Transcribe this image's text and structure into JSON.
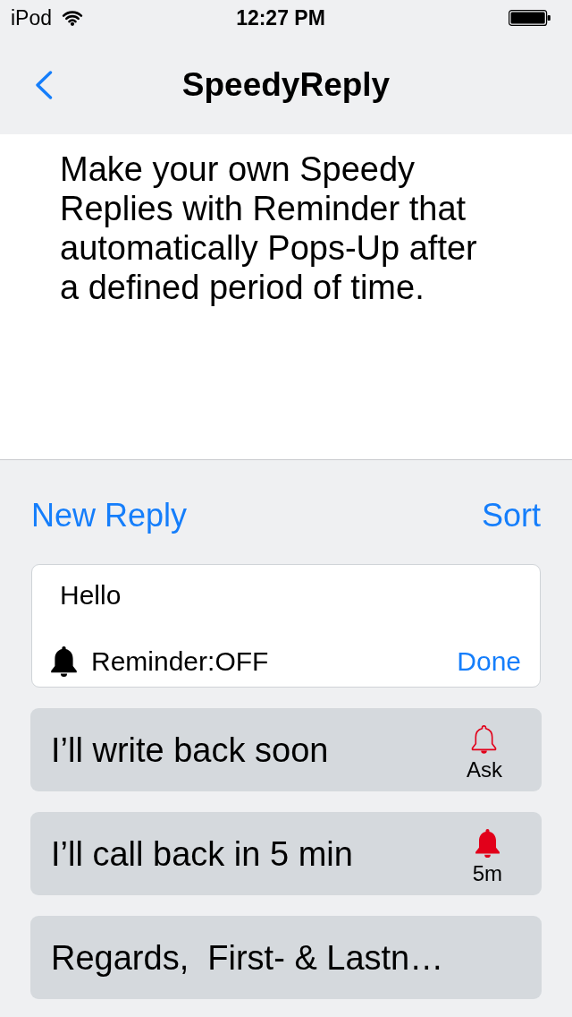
{
  "status_bar": {
    "carrier": "iPod",
    "time": "12:27 PM"
  },
  "nav": {
    "title": "SpeedyReply"
  },
  "description": "Make your own Speedy Replies with Reminder that automatically Pops-Up after a defined period of time.",
  "toolbar": {
    "new_button": "New Reply",
    "sort_button": "Sort"
  },
  "editor": {
    "value": "Hello",
    "reminder": "Reminder:OFF",
    "done_button": "Done"
  },
  "replies": [
    {
      "text": "I’ll write back soon",
      "reminder": {
        "kind": "ask",
        "label": "Ask"
      }
    },
    {
      "text": "I’ll call back in 5 min",
      "reminder": {
        "kind": "timer",
        "label": "5m"
      }
    },
    {
      "text": "Regards,  First- & Lastn…"
    }
  ]
}
